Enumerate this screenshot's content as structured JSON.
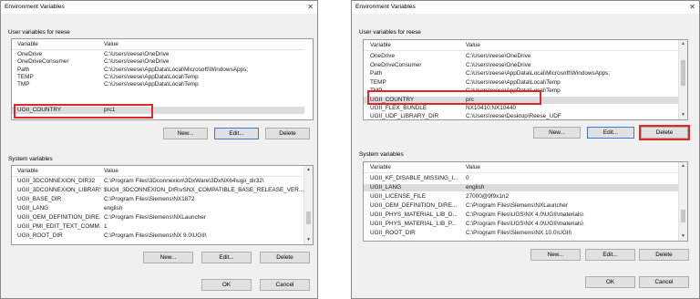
{
  "left": {
    "title": "Environment Variables",
    "close_glyph": "✕",
    "user_group_label": "User variables for reese",
    "columns": [
      "Variable",
      "Value"
    ],
    "user_rows": [
      {
        "name": "OneDrive",
        "value": "C:\\Users\\reese\\OneDrive"
      },
      {
        "name": "OneDriveConsumer",
        "value": "C:\\Users\\reese\\OneDrive"
      },
      {
        "name": "Path",
        "value": "C:\\Users\\reese\\AppData\\Local\\Microsoft\\WindowsApps;"
      },
      {
        "name": "TEMP",
        "value": "C:\\Users\\reese\\AppData\\Local\\Temp"
      },
      {
        "name": "TMP",
        "value": "C:\\Users\\reese\\AppData\\Local\\Temp"
      },
      {
        "name": "UGII_COUNTRY",
        "value": "prc1"
      }
    ],
    "buttons": {
      "new": "New...",
      "edit": "Edit...",
      "delete": "Delete"
    },
    "system_group_label": "System variables",
    "system_rows": [
      {
        "name": "UGII_3DCONNEXION_DIR32",
        "value": "C:\\Program Files\\3Dconnexion\\3DxWare\\3DxNX64\\ugii_dir32\\"
      },
      {
        "name": "UGII_3DCONNEXION_LIBRARY",
        "value": "$UGII_3DCONNEXION_DIR\\vSNX_COMPATIBLE_BASE_RELEASE_VER..."
      },
      {
        "name": "UGII_BASE_DIR",
        "value": "C:\\Program Files\\Siemens\\NX1872"
      },
      {
        "name": "UGII_LANG",
        "value": "english"
      },
      {
        "name": "UGII_OEM_DEFINITION_DIRE...",
        "value": "C:\\Program Files\\Siemens\\NXLauncher"
      },
      {
        "name": "UGII_PMI_EDIT_TEXT_COMM...",
        "value": "1"
      },
      {
        "name": "UGII_ROOT_DIR",
        "value": "C:\\Program Files\\Siemens\\NX 9.0\\UGII\\"
      }
    ],
    "sys_buttons": {
      "new": "New...",
      "edit": "Edit...",
      "delete": "Delete"
    },
    "ok": "OK",
    "cancel": "Cancel"
  },
  "right": {
    "title": "Environment Variables",
    "close_glyph": "✕",
    "user_group_label": "User variables for reese",
    "columns": [
      "Variable",
      "Value"
    ],
    "user_rows": [
      {
        "name": "OneDrive",
        "value": "C:\\Users\\reese\\OneDrive"
      },
      {
        "name": "OneDriveConsumer",
        "value": "C:\\Users\\reese\\OneDrive"
      },
      {
        "name": "Path",
        "value": "C:\\Users\\reese\\AppData\\Local\\Microsoft\\WindowsApps;"
      },
      {
        "name": "TEMP",
        "value": "C:\\Users\\reese\\AppData\\Local\\Temp"
      },
      {
        "name": "TMP",
        "value": "C:\\Users\\reese\\AppData\\Local\\Temp"
      },
      {
        "name": "UGII_COUNTRY",
        "value": "prc"
      },
      {
        "name": "UGII_FLEX_BUNDLE",
        "value": "NX10410;NX10440"
      },
      {
        "name": "UGII_UDF_LIBRARY_DIR",
        "value": "C:\\Users\\reese\\Desktop\\Reese_UDF"
      }
    ],
    "buttons": {
      "new": "New...",
      "edit": "Edit...",
      "delete": "Delete"
    },
    "system_group_label": "System variables",
    "system_rows": [
      {
        "name": "UGII_KF_DISABLE_MISSING_I...",
        "value": "0"
      },
      {
        "name": "UGII_LANG",
        "value": "english"
      },
      {
        "name": "UGII_LICENSE_FILE",
        "value": "27000@9f9x1n2"
      },
      {
        "name": "UGII_OEM_DEFINITION_DIRE...",
        "value": "C:\\Program Files\\Siemens\\NXLauncher"
      },
      {
        "name": "UGII_PHYS_MATERIAL_LIB_D...",
        "value": "C:\\Program Files\\UGS\\NX 4.0\\UGII\\materials\\"
      },
      {
        "name": "UGII_PHYS_MATERIAL_LIB_P...",
        "value": "C:\\Program Files\\UGS\\NX 4.0\\UGII\\materials\\"
      },
      {
        "name": "UGII_ROOT_DIR",
        "value": "C:\\Program Files\\Siemens\\NX 10.0\\UGII\\"
      }
    ],
    "sys_buttons": {
      "new": "New...",
      "edit": "Edit...",
      "delete": "Delete"
    },
    "ok": "OK",
    "cancel": "Cancel"
  },
  "icons": {
    "scroll_up": "▲",
    "scroll_down": "▼"
  },
  "colors": {
    "highlight": "#d9292b",
    "focus": "#3b7ad6",
    "dialog_bg": "#f0f0f0"
  }
}
